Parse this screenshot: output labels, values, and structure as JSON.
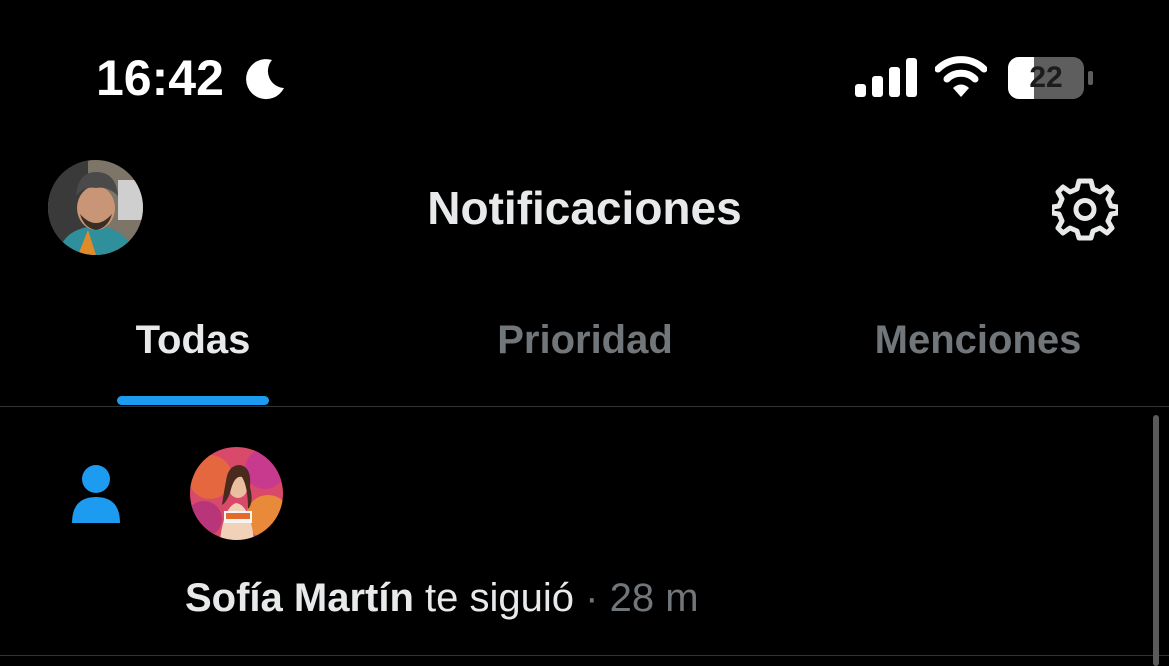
{
  "status_bar": {
    "time": "16:42",
    "battery_level": "22",
    "icons": [
      "moon-icon",
      "signal-icon",
      "wifi-icon",
      "battery-icon"
    ]
  },
  "header": {
    "title": "Notificaciones",
    "avatar_icon": "avatar",
    "settings_icon": "gear-icon"
  },
  "tabs": [
    {
      "label": "Todas",
      "active": true
    },
    {
      "label": "Prioridad",
      "active": false
    },
    {
      "label": "Menciones",
      "active": false
    }
  ],
  "notifications": [
    {
      "type_icon": "person-icon",
      "user_name": "Sofía Martín",
      "action": "te siguió",
      "separator": "·",
      "time": "28 m"
    }
  ],
  "colors": {
    "background": "#000000",
    "text_primary": "#e7e9ea",
    "text_secondary": "#71767b",
    "accent": "#1d9bf0",
    "divider": "#2f3336"
  }
}
